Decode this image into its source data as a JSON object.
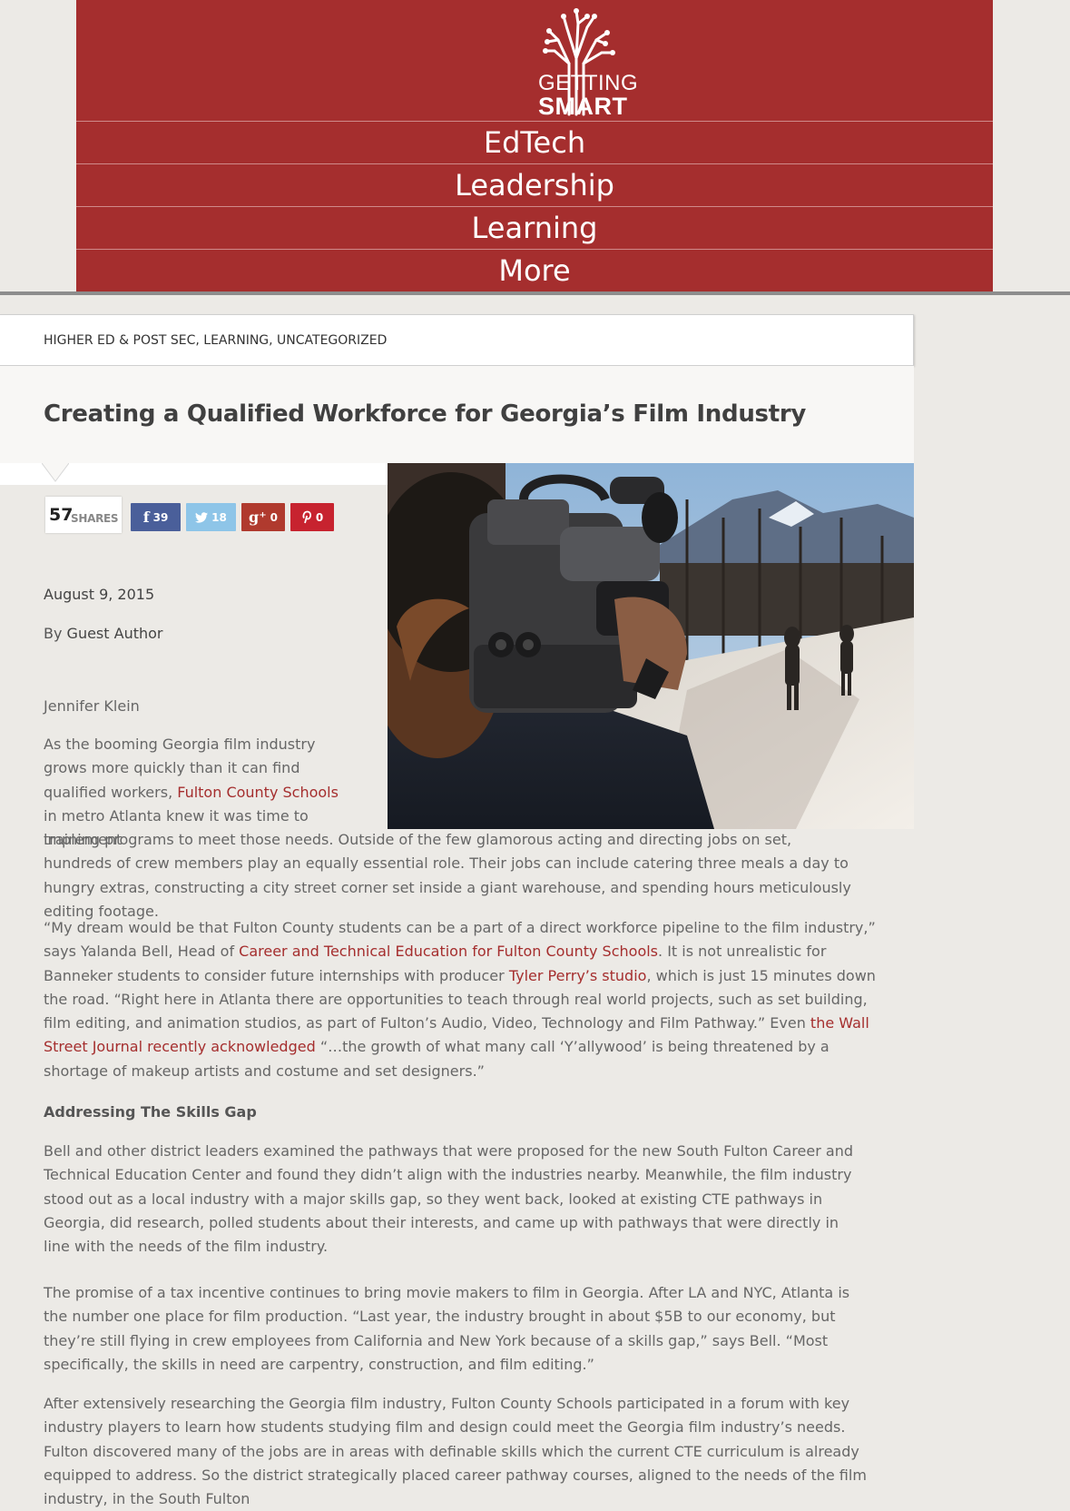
{
  "header": {
    "logo": {
      "line1": "GETTING",
      "line2": "SMART"
    },
    "nav": [
      "EdTech",
      "Leadership",
      "Learning",
      "More"
    ],
    "brand_color": "#a52e2e"
  },
  "article": {
    "categories": [
      "HIGHER ED & POST SEC",
      "LEARNING",
      "UNCATEGORIZED"
    ],
    "title": "Creating a Qualified Workforce for Georgia’s Film Industry",
    "shares": {
      "total": "57",
      "label": "SHARES",
      "facebook": "39",
      "twitter": "18",
      "google_plus": "0",
      "pinterest": "0"
    },
    "date": "August 9, 2015",
    "byline_prefix": "By",
    "author": "Guest Author",
    "writer": "Jennifer Klein",
    "p1": {
      "t1": "As the booming Georgia film industry grows more quickly than it can find qualified workers, ",
      "link1": "Fulton County Schools",
      "t2": " in metro Atlanta knew it was time to implement",
      "t3": "training programs to meet those needs. Outside of the few glamorous acting and directing jobs on set, hundreds of crew members play an equally essential role. Their jobs can include catering three meals a day to hungry extras, constructing a city street corner set inside a giant warehouse, and spending hours meticulously editing footage."
    },
    "p2": {
      "t1": "“My dream would be that Fulton County students can be a part of a direct workforce pipeline to the film industry,” says Yalanda Bell, Head of ",
      "link1": "Career and Technical Education for Fulton County Schools",
      "t2": ". It is not unrealistic for Banneker students to consider future internships with producer ",
      "link2": "Tyler Perry’s studio",
      "t3": ", which is just 15 minutes down the road. “Right here in Atlanta there are opportunities to teach through real world projects, such as set building, film editing, and animation studios, as part of Fulton’s Audio, Video, Technology and Film Pathway.” Even ",
      "link3": "the Wall Street Journal recently acknowledged",
      "t4": " “…the growth of what many call ‘Y’allywood’ is being threatened by a shortage of makeup artists and costume and set designers.”"
    },
    "subhead": "Addressing The Skills Gap",
    "p3": "Bell and other district leaders examined the pathways that were proposed for the new South Fulton Career and Technical Education Center and found they didn’t align with the industries nearby. Meanwhile, the film industry stood out as a local industry with a major skills gap, so they went back, looked at existing CTE pathways in Georgia, did research, polled students about their interests, and came up with pathways that were directly in line with the needs of the film industry.",
    "p4": "The promise of a tax incentive continues to bring movie makers to film in Georgia. After LA and NYC, Atlanta is the number one place for film production. “Last year, the industry brought in about $5B to our economy, but they’re still flying in crew employees from California and New York because of a skills gap,” says Bell. “Most specifically, the skills in need are carpentry, construction, and film editing.”",
    "p5": "After extensively researching the Georgia film industry, Fulton County Schools participated in a forum with key industry players to learn how students studying film and design could meet the Georgia film industry’s needs. Fulton discovered many of the jobs are in areas with definable skills which the current CTE curriculum is already equipped to address. So the district strategically placed career pathway courses, aligned to the needs of the film industry, in the South Fulton"
  }
}
